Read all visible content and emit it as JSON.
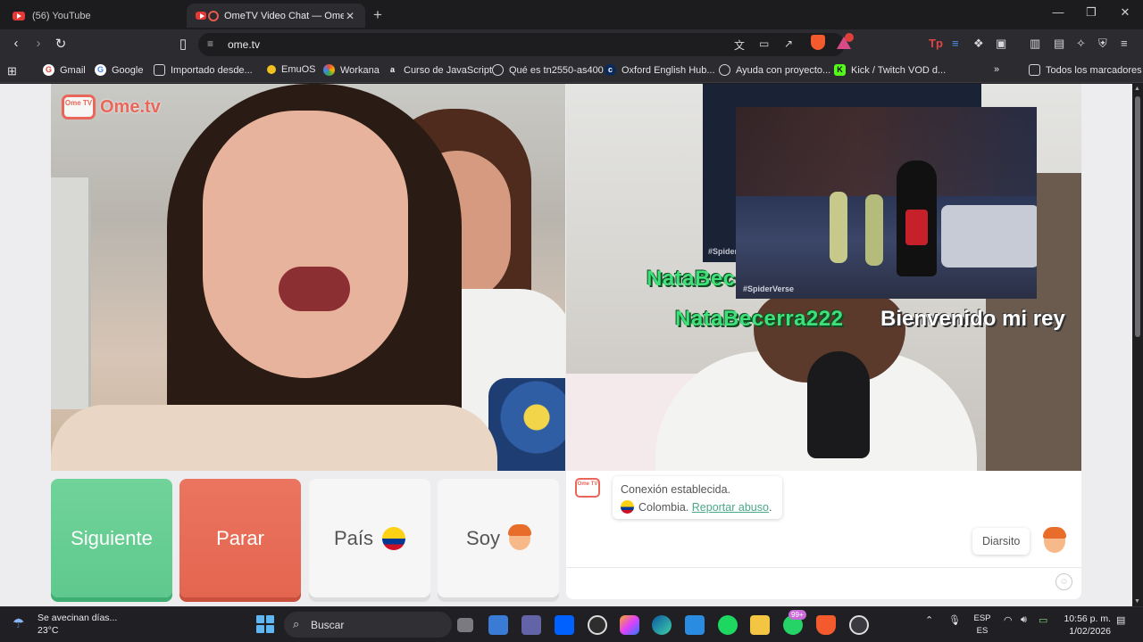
{
  "browser": {
    "tabs": [
      {
        "title": "(56) YouTube",
        "active": false
      },
      {
        "title": "OmeTV Video Chat — Omegl",
        "active": true
      }
    ],
    "url": "ome.tv",
    "bookmarks": [
      {
        "label": "Gmail",
        "icon": "gmail-icon"
      },
      {
        "label": "Google",
        "icon": "google-icon"
      },
      {
        "label": "Importado desde...",
        "icon": "folder-icon"
      },
      {
        "label": "EmuOS",
        "icon": "emuos-icon"
      },
      {
        "label": "Workana",
        "icon": "workana-icon"
      },
      {
        "label": "Curso de JavaScript",
        "icon": "platzi-icon"
      },
      {
        "label": "Qué es tn2550-as400",
        "icon": "web-icon"
      },
      {
        "label": "Oxford English Hub...",
        "icon": "oxford-icon"
      },
      {
        "label": "Ayuda con proyecto...",
        "icon": "chatgpt-icon"
      },
      {
        "label": "Kick / Twitch VOD d...",
        "icon": "kick-icon"
      }
    ],
    "all_bookmarks": "Todos los marcadores"
  },
  "ometv": {
    "logo_text": "Ome.tv",
    "logo_badge": "Ome TV",
    "stream_overlay": {
      "name_top": "NataBecerra222",
      "name": "NataBecerra222",
      "message": "Bienvenido mi rey",
      "movie_tag": "#SpiderVerse",
      "movie_tag_back": "#Spider"
    },
    "buttons": {
      "next": "Siguiente",
      "stop": "Parar",
      "country": "País",
      "gender": "Soy"
    },
    "chat": {
      "system_line1": "Conexión establecida.",
      "country": "Colombia.",
      "report": "Reportar abuso",
      "report_suffix": ".",
      "user_message": "Diarsito"
    }
  },
  "taskbar": {
    "weather_line1": "Se avecinan días...",
    "weather_line2": "23°C",
    "search_label": "Buscar",
    "whatsapp_badge": "99+",
    "lang_line1": "ESP",
    "lang_line2": "ES",
    "time": "10:56 p. m.",
    "date": "1/02/2026"
  },
  "colors": {
    "next_button": "#5fc98d",
    "stop_button": "#e4654f",
    "brand": "#e8675a",
    "overlay_name": "#3fe07a"
  }
}
